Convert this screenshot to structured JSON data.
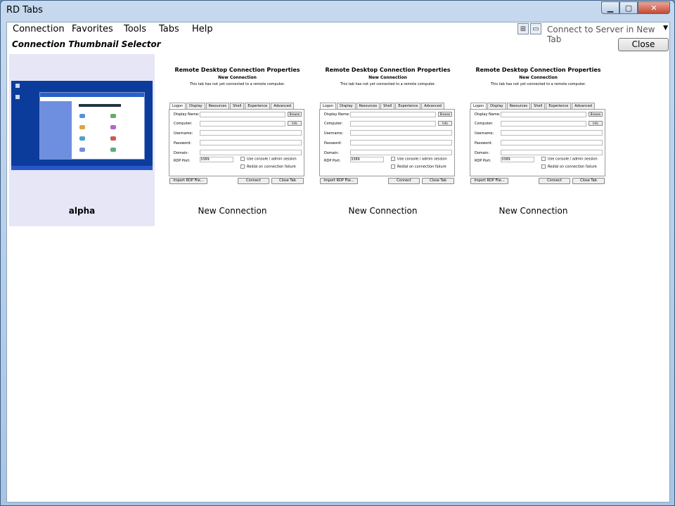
{
  "window": {
    "title": "RD Tabs"
  },
  "menu": {
    "items": [
      "Connection",
      "Favorites",
      "Tools",
      "Tabs",
      "Help"
    ]
  },
  "server": {
    "combo_text": "Connect to Server in New Tab"
  },
  "selector": {
    "title": "Connection Thumbnail Selector",
    "close_label": "Close"
  },
  "thumbnails": [
    {
      "label": "alpha",
      "selected": true
    },
    {
      "label": "New Connection",
      "selected": false
    },
    {
      "label": "New Connection",
      "selected": false
    },
    {
      "label": "New Connection",
      "selected": false
    }
  ],
  "rdp": {
    "title": "Remote Desktop Connection Properties",
    "subtitle": "New Connection",
    "note": "This tab has not yet connected to a remote computer.",
    "tabs": [
      "Logon",
      "Display",
      "Resources",
      "Shell",
      "Experience",
      "Advanced"
    ],
    "labels": [
      "Display Name:",
      "Computer:",
      "Username:",
      "Password:",
      "Domain:",
      "RDP Port:"
    ],
    "port_value": "3389",
    "browse": "Browse",
    "info": "Info",
    "check_console": "Use console / admin session",
    "check_redial": "Redial on connection failure",
    "import": "Import RDP File...",
    "connect": "Connect",
    "close_tab": "Close Tab"
  },
  "colors": {
    "selected_bg": "#e6e6f7",
    "desktop_bg": "#0b3c9c"
  }
}
